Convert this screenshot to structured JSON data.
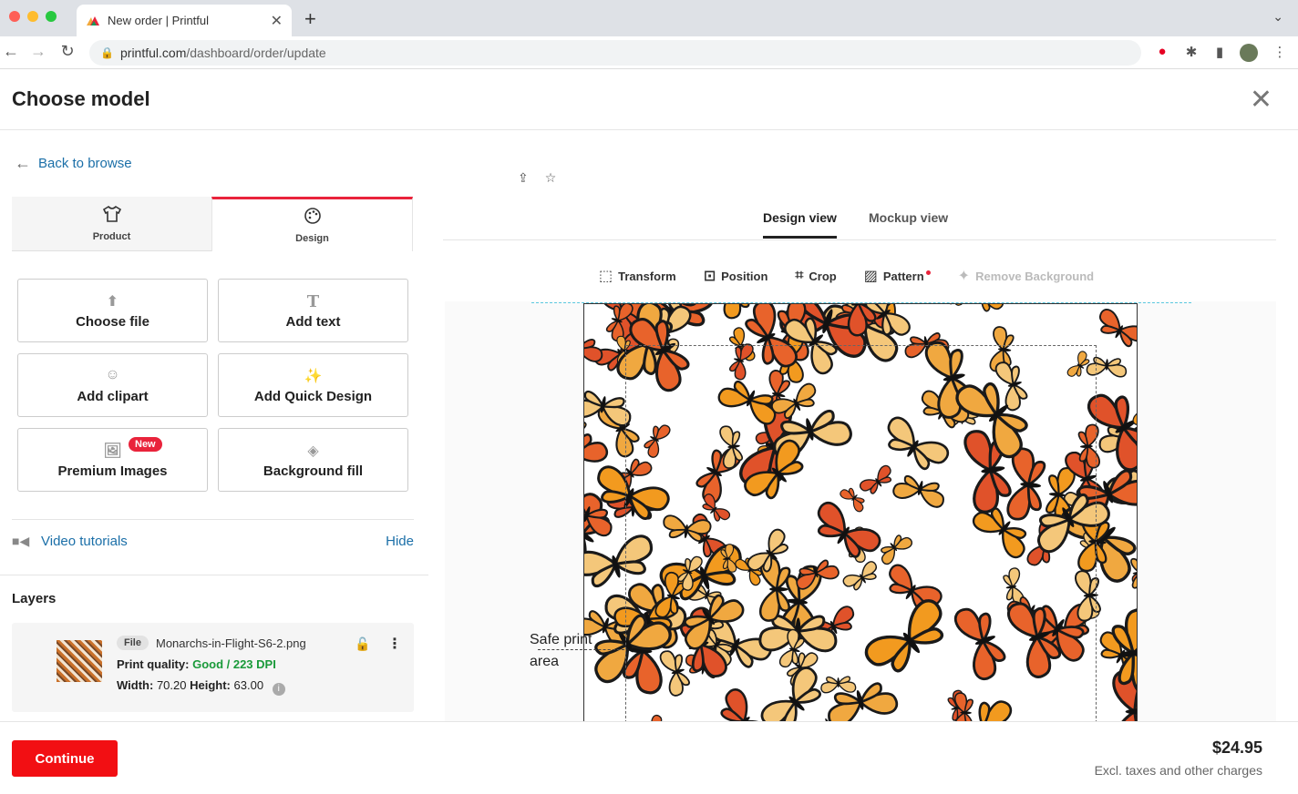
{
  "browser": {
    "tab_title": "New order | Printful",
    "url_domain": "printful.com",
    "url_path": "/dashboard/order/update"
  },
  "header": {
    "title": "Choose model"
  },
  "sidebar": {
    "back_label": "Back to browse",
    "tabs": [
      {
        "label": "Product",
        "icon": "tshirt-icon"
      },
      {
        "label": "Design",
        "icon": "palette-icon"
      }
    ],
    "actions": [
      {
        "label": "Choose file",
        "icon": "upload-icon"
      },
      {
        "label": "Add text",
        "icon": "text-icon"
      },
      {
        "label": "Add clipart",
        "icon": "smiley-icon"
      },
      {
        "label": "Add Quick Design",
        "icon": "sparkle-icon"
      },
      {
        "label": "Premium Images",
        "icon": "image-icon",
        "badge": "New"
      },
      {
        "label": "Background fill",
        "icon": "paint-bucket-icon"
      }
    ],
    "video_label": "Video tutorials",
    "hide_label": "Hide",
    "layers_title": "Layers",
    "layer": {
      "chip": "File",
      "filename": "Monarchs-in-Flight-S6-2.png",
      "quality_label": "Print quality:",
      "quality_value": "Good / 223 DPI",
      "width_label": "Width:",
      "width_value": "70.20",
      "height_label": "Height:",
      "height_value": "63.00"
    }
  },
  "editor": {
    "view_tabs": [
      "Design view",
      "Mockup view"
    ],
    "tools": [
      "Transform",
      "Position",
      "Crop",
      "Pattern",
      "Remove Background"
    ],
    "safe_label_1": "Safe print",
    "safe_label_2": "area"
  },
  "footer": {
    "continue_label": "Continue",
    "price": "$24.95",
    "price_note": "Excl. taxes and other charges"
  },
  "colors": {
    "accent": "#e9233b",
    "link": "#1b6fa8",
    "good": "#1a9a3a",
    "cta": "#f20f13"
  }
}
